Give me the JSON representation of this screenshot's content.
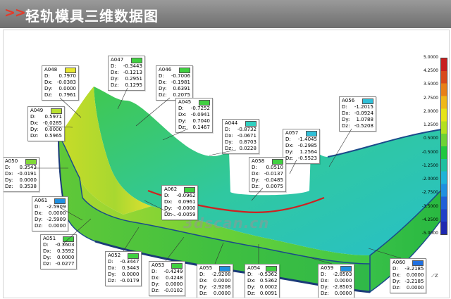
{
  "header": {
    "arrows": ">>",
    "title": "轻轨模具三维数据图"
  },
  "watermark": "3dscan.cn",
  "scale": {
    "ticks": [
      "5.0000",
      "4.2500",
      "3.5000",
      "2.7500",
      "2.0000",
      "1.2500",
      "0.5000",
      "-0.5000",
      "-1.2500",
      "-2.0000",
      "-2.7500",
      "-3.5000",
      "-4.2500",
      "-5.0000"
    ],
    "colors": [
      "#c81e1e",
      "#d84a1c",
      "#e88018",
      "#f0b818",
      "#e6e418",
      "#b4e020",
      "#6ed234",
      "#22c840",
      "#20c0a0",
      "#20b4d8",
      "#2090e0",
      "#2060d8",
      "#2040c8",
      "#1e28b0"
    ]
  },
  "axis_label": "Z",
  "callouts": [
    {
      "id": "A047",
      "color": "#40d040",
      "D": "-0.3443",
      "Dx": "-0.1213",
      "Dy": "0.2951",
      "Dz": "0.1295"
    },
    {
      "id": "A048",
      "color": "#e8e830",
      "D": "0.7970",
      "Dx": "-0.0383",
      "Dy": "0.0000",
      "Dz": "0.7961"
    },
    {
      "id": "A046",
      "color": "#40d040",
      "D": "-0.7006",
      "Dx": "-0.1981",
      "Dy": "0.6391",
      "Dz": "0.2075"
    },
    {
      "id": "A045",
      "color": "#40d040",
      "D": "-0.7252",
      "Dx": "-0.0941",
      "Dy": "0.7040",
      "Dz": "0.1467"
    },
    {
      "id": "A049",
      "color": "#b8e030",
      "D": "0.5971",
      "Dx": "-0.0285",
      "Dy": "0.0000",
      "Dz": "0.5965"
    },
    {
      "id": "A044",
      "color": "#30d0c0",
      "D": "-0.8732",
      "Dx": "-0.0671",
      "Dy": "0.8703",
      "Dz": "0.0228"
    },
    {
      "id": "A056",
      "color": "#30c0d8",
      "D": "-1.2015",
      "Dx": "-0.0924",
      "Dy": "1.0788",
      "Dz": "-0.5208"
    },
    {
      "id": "A057",
      "color": "#30c0d8",
      "D": "-1.4045",
      "Dx": "-0.2985",
      "Dy": "1.2564",
      "Dz": "-0.5523"
    },
    {
      "id": "A050",
      "color": "#80d838",
      "D": "0.3543",
      "Dx": "-0.0191",
      "Dy": "0.0000",
      "Dz": "0.3538"
    },
    {
      "id": "A058",
      "color": "#40d040",
      "D": "0.0510",
      "Dx": "-0.0137",
      "Dy": "-0.0485",
      "Dz": "0.0075"
    },
    {
      "id": "A062",
      "color": "#40d040",
      "D": "-0.0962",
      "Dx": "0.0961",
      "Dy": "-0.0000",
      "Dz": "-0.0059"
    },
    {
      "id": "A061",
      "color": "#2090e0",
      "D": "-2.5909",
      "Dx": "0.0000",
      "Dy": "-2.5909",
      "Dz": "0.0000"
    },
    {
      "id": "A051",
      "color": "#40d040",
      "D": "-0.3603",
      "Dx": "0.3592",
      "Dy": "0.0000",
      "Dz": "-0.0277"
    },
    {
      "id": "A052",
      "color": "#40d040",
      "D": "-0.3447",
      "Dx": "0.3443",
      "Dy": "0.0000",
      "Dz": "-0.0179"
    },
    {
      "id": "A053",
      "color": "#40d040",
      "D": "-0.4249",
      "Dx": "0.4248",
      "Dy": "0.0000",
      "Dz": "-0.0102"
    },
    {
      "id": "A055",
      "color": "#2090e0",
      "D": "-2.9208",
      "Dx": "0.0000",
      "Dy": "-2.9208",
      "Dz": "0.0000"
    },
    {
      "id": "A054",
      "color": "#40d040",
      "D": "-0.5362",
      "Dx": "0.5362",
      "Dy": "0.0002",
      "Dz": "0.0091"
    },
    {
      "id": "A059",
      "color": "#2090e0",
      "D": "-2.8503",
      "Dx": "0.0000",
      "Dy": "-2.8503",
      "Dz": "0.0000"
    },
    {
      "id": "A060",
      "color": "#2070e0",
      "D": "-3.2185",
      "Dx": "0.0000",
      "Dy": "-3.2185",
      "Dz": "0.0000"
    }
  ]
}
